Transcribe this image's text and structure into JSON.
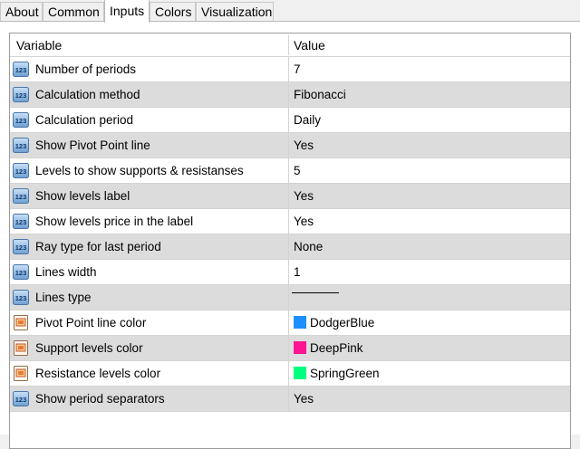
{
  "tabs": [
    "About",
    "Common",
    "Inputs",
    "Colors",
    "Visualization"
  ],
  "active_tab": "Inputs",
  "grid": {
    "headers": {
      "variable": "Variable",
      "value": "Value"
    },
    "rows": [
      {
        "label": "Number of periods",
        "value": "7",
        "type": "number",
        "icon": "number-123-icon",
        "shaded": false
      },
      {
        "label": "Calculation method",
        "value": "Fibonacci",
        "type": "text",
        "icon": "number-123-icon",
        "shaded": true
      },
      {
        "label": "Calculation period",
        "value": "Daily",
        "type": "text",
        "icon": "number-123-icon",
        "shaded": false
      },
      {
        "label": "Show Pivot Point line",
        "value": "Yes",
        "type": "text",
        "icon": "number-123-icon",
        "shaded": true
      },
      {
        "label": "Levels to show supports & resistanses",
        "value": "5",
        "type": "number",
        "icon": "number-123-icon",
        "shaded": false
      },
      {
        "label": "Show levels label",
        "value": "Yes",
        "type": "text",
        "icon": "number-123-icon",
        "shaded": true
      },
      {
        "label": "Show levels price in the label",
        "value": "Yes",
        "type": "text",
        "icon": "number-123-icon",
        "shaded": false
      },
      {
        "label": "Ray type for last period",
        "value": "None",
        "type": "text",
        "icon": "number-123-icon",
        "shaded": true
      },
      {
        "label": "Lines width",
        "value": "1",
        "type": "number",
        "icon": "number-123-icon",
        "shaded": false
      },
      {
        "label": "Lines type",
        "value": "",
        "type": "line-style",
        "icon": "number-123-icon",
        "shaded": true
      },
      {
        "label": "Pivot Point line color",
        "value": "DodgerBlue",
        "type": "color",
        "color": "#1e90ff",
        "icon": "color-palette-icon",
        "shaded": false
      },
      {
        "label": "Support levels color",
        "value": "DeepPink",
        "type": "color",
        "color": "#ff1493",
        "icon": "color-palette-icon",
        "shaded": true
      },
      {
        "label": "Resistance levels color",
        "value": "SpringGreen",
        "type": "color",
        "color": "#00ff7f",
        "icon": "color-palette-icon",
        "shaded": false
      },
      {
        "label": "Show period separators",
        "value": "Yes",
        "type": "text",
        "icon": "number-123-icon",
        "shaded": true
      }
    ]
  }
}
